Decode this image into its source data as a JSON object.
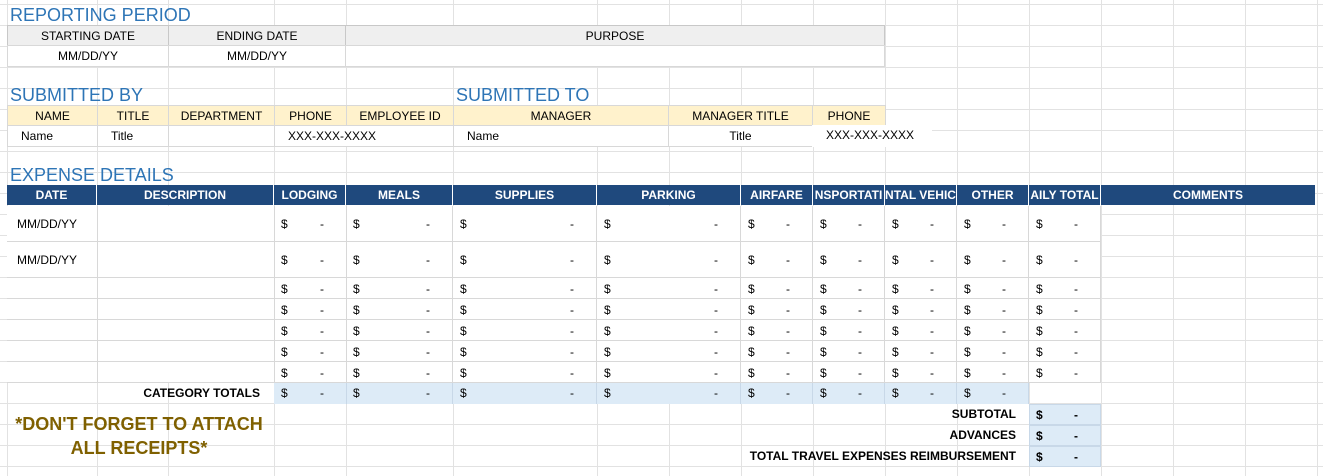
{
  "reporting_period": {
    "title": "REPORTING PERIOD",
    "starting_date_label": "STARTING DATE",
    "ending_date_label": "ENDING DATE",
    "purpose_label": "PURPOSE",
    "starting_date_value": "MM/DD/YY",
    "ending_date_value": "MM/DD/YY",
    "purpose_value": ""
  },
  "submitted_by": {
    "title": "SUBMITTED BY",
    "name_label": "NAME",
    "title_label": "TITLE",
    "department_label": "DEPARTMENT",
    "phone_label": "PHONE",
    "employee_id_label": "EMPLOYEE ID",
    "name_value": "Name",
    "title_value": "Title",
    "department_value": "",
    "phone_value": "XXX-XXX-XXXX",
    "employee_id_value": ""
  },
  "submitted_to": {
    "title": "SUBMITTED TO",
    "manager_label": "MANAGER",
    "manager_title_label": "MANAGER TITLE",
    "phone_label": "PHONE",
    "manager_value": "Name",
    "manager_title_value": "Title",
    "phone_value": "XXX-XXX-XXXX"
  },
  "expense_details": {
    "title": "EXPENSE DETAILS",
    "columns": {
      "date": "DATE",
      "description": "DESCRIPTION",
      "lodging": "LODGING",
      "meals": "MEALS",
      "supplies": "SUPPLIES",
      "parking": "PARKING",
      "airfare": "AIRFARE",
      "transportation": "NSPORTATI",
      "rental_vehicle": "NTAL VEHIC",
      "other": "OTHER",
      "daily_total": "AILY TOTAL",
      "comments": "COMMENTS"
    },
    "rows": [
      {
        "date": "MM/DD/YY"
      },
      {
        "date": "MM/DD/YY"
      },
      {
        "date": ""
      },
      {
        "date": ""
      },
      {
        "date": ""
      },
      {
        "date": ""
      },
      {
        "date": ""
      }
    ],
    "currency_symbol": "$",
    "empty_amount": "-",
    "category_totals_label": "CATEGORY TOTALS"
  },
  "summary": {
    "subtotal_label": "SUBTOTAL",
    "advances_label": "ADVANCES",
    "total_label": "TOTAL TRAVEL EXPENSES REIMBURSEMENT",
    "currency_symbol": "$",
    "empty_amount": "-"
  },
  "reminder": {
    "line1": "*DON'T FORGET TO ATTACH",
    "line2": "ALL RECEIPTS*"
  },
  "colors": {
    "section_title": "#2e75b6",
    "table_header": "#1f497d",
    "yellow_header": "#fff2cc",
    "gray_header": "#efefef",
    "totals_fill": "#ddebf7",
    "reminder_text": "#7f6000"
  }
}
